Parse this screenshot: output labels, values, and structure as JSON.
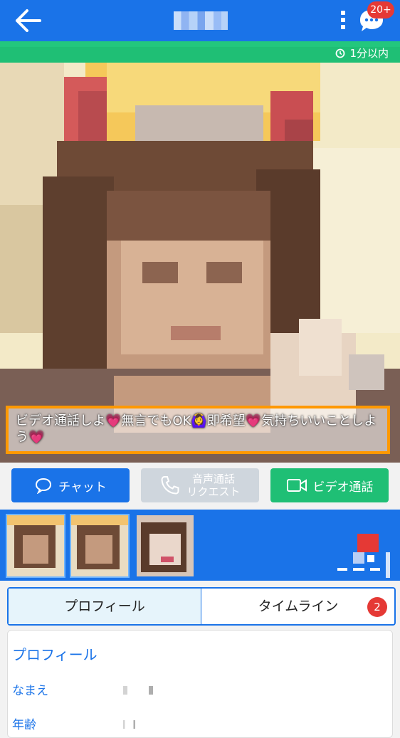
{
  "header": {
    "back_icon": "arrow-left-icon",
    "menu_icon": "kebab-menu-icon",
    "message_icon": "chat-bubble-icon",
    "message_badge": "20+"
  },
  "status": {
    "clock_icon": "clock-icon",
    "last_login": "1分以内"
  },
  "photo": {
    "caption": "ビデオ通話しよ💗無言でもOK🙆‍♀️即希望💗気持ちいいことしよう💗"
  },
  "actions": {
    "chat_label": "チャット",
    "voice_label_line1": "音声通話",
    "voice_label_line2": "リクエスト",
    "video_label": "ビデオ通話"
  },
  "tabs": {
    "profile_label": "プロフィール",
    "timeline_label": "タイムライン",
    "timeline_badge": "2"
  },
  "profile": {
    "title": "プロフィール",
    "fields": [
      {
        "label": "なまえ"
      },
      {
        "label": "年齢"
      }
    ]
  },
  "colors": {
    "primary": "#1a73e8",
    "green": "#1fbf75",
    "badge": "#e53935",
    "caption_border": "#ff9800",
    "disabled": "#cfd6dd"
  }
}
